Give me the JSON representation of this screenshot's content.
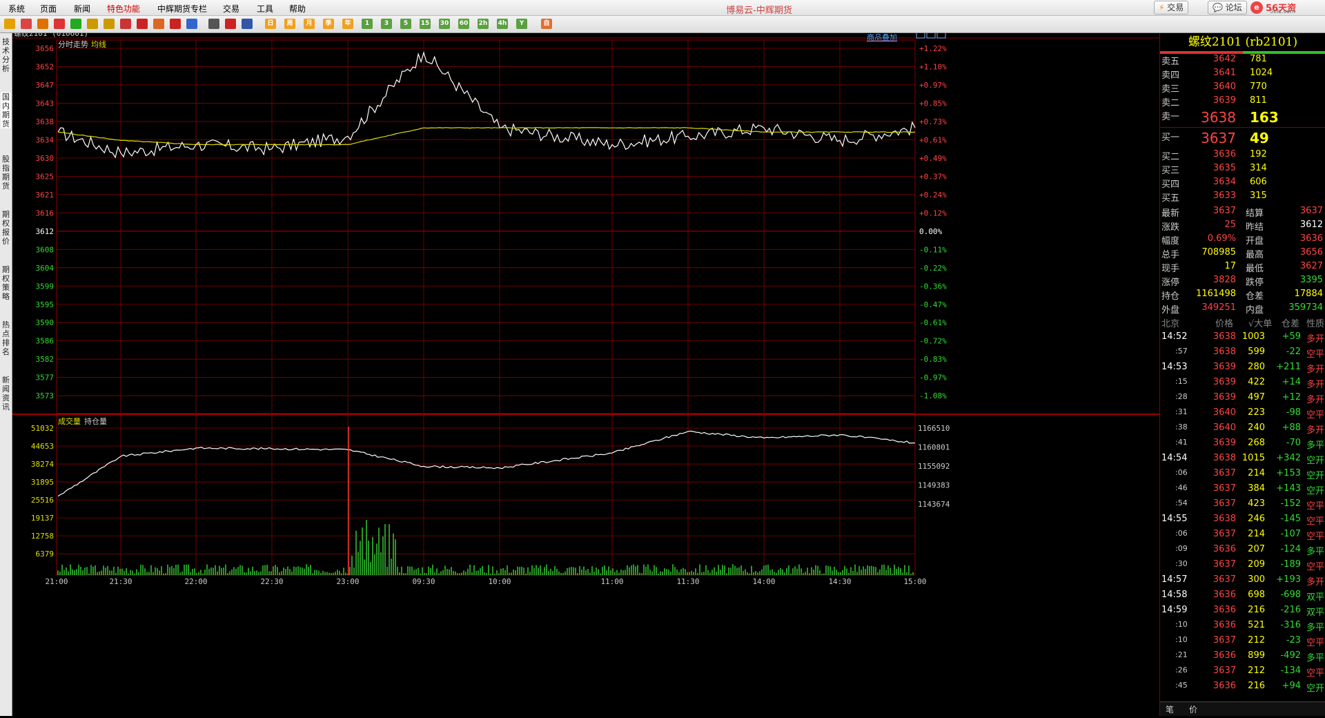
{
  "menu": [
    "系统",
    "页面",
    "新闻",
    "特色功能",
    "中辉期货专栏",
    "交易",
    "工具",
    "帮助"
  ],
  "app_title": "博易云-中辉期货",
  "buttons": {
    "trade": "交易",
    "forum": "论坛"
  },
  "logo": {
    "mark": "e",
    "text": "56天资",
    "sub": "5etz.com"
  },
  "toolbar": {
    "icons": [
      "back-icon",
      "home-icon",
      "book-icon",
      "news-icon",
      "refresh-icon",
      "zoom-in-icon",
      "zoom-out-icon",
      "window-icon",
      "pen-icon",
      "paint-icon",
      "funnel-icon",
      "star-icon",
      "table-icon",
      "chart-icon",
      "split-icon"
    ],
    "periods": [
      "日",
      "周",
      "月",
      "季",
      "年",
      "1",
      "3",
      "5",
      "15",
      "30",
      "60",
      "2h",
      "4h",
      "Y",
      "自"
    ]
  },
  "left_tabs": [
    "技术分析",
    "国内期货",
    "股指期货",
    "期权报价",
    "期权策略",
    "热点排名",
    "新闻资讯"
  ],
  "chart": {
    "symbol": "螺纹2101 (010601)",
    "overlay_link": "商品叠加",
    "price_label": "分时走势",
    "avg_label": "均线",
    "volume_label": "成交量",
    "oi_label": "持仓量",
    "price_ticks": [
      "3656",
      "3652",
      "3647",
      "3643",
      "3638",
      "3634",
      "3630",
      "3625",
      "3621",
      "3616",
      "3612",
      "3608",
      "3604",
      "3599",
      "3595",
      "3590",
      "3586",
      "3582",
      "3577",
      "3573"
    ],
    "pct_ticks": [
      "+1.22%",
      "+1.10%",
      "+0.97%",
      "+0.85%",
      "+0.73%",
      "+0.61%",
      "+0.49%",
      "+0.37%",
      "+0.24%",
      "+0.12%",
      "0.00%",
      "-0.11%",
      "-0.22%",
      "-0.36%",
      "-0.47%",
      "-0.61%",
      "-0.72%",
      "-0.83%",
      "-0.97%",
      "-1.08%"
    ],
    "vol_ticks": [
      "51032",
      "44653",
      "38274",
      "31895",
      "25516",
      "19137",
      "12758",
      "6379"
    ],
    "oi_ticks": [
      "1166510",
      "1160801",
      "1155092",
      "1149383",
      "1143674"
    ],
    "time_ticks": [
      "21:00",
      "21:30",
      "22:00",
      "22:30",
      "23:00",
      "09:30",
      "10:00",
      "11:00",
      "11:30",
      "14:00",
      "14:30",
      "15:00"
    ],
    "colors": {
      "grid": "#8b0000",
      "price_up": "#ff4444",
      "price_down": "#33dd33",
      "line": "#ffffff",
      "avg": "#e0e000"
    }
  },
  "chart_data": {
    "type": "line",
    "title": "螺纹2101 (010601)",
    "x": [
      "21:00",
      "21:30",
      "22:00",
      "22:30",
      "23:00",
      "09:30",
      "10:00",
      "11:00",
      "11:30",
      "14:00",
      "14:30",
      "15:00"
    ],
    "ylim": [
      3573,
      3656
    ],
    "series": [
      {
        "name": "分时走势",
        "values": [
          3636,
          3631,
          3633,
          3632,
          3635,
          3655,
          3637,
          3633,
          3635,
          3637,
          3634,
          3637
        ]
      },
      {
        "name": "均线",
        "values": [
          3636,
          3634,
          3633,
          3633,
          3633,
          3637,
          3637,
          3637,
          3637,
          3636,
          3636,
          3636
        ]
      },
      {
        "name": "持仓量",
        "values": [
          1146000,
          1158000,
          1160500,
          1160300,
          1160000,
          1155000,
          1154500,
          1159000,
          1165500,
          1163500,
          1164500,
          1162000
        ]
      }
    ],
    "volume_ylim": [
      0,
      51032
    ],
    "oi_ylim": [
      1143674,
      1166510
    ]
  },
  "quote": {
    "title": "螺纹2101 (rb2101)",
    "asks": [
      {
        "label": "卖五",
        "price": "3642",
        "vol": "781"
      },
      {
        "label": "卖四",
        "price": "3641",
        "vol": "1024"
      },
      {
        "label": "卖三",
        "price": "3640",
        "vol": "770"
      },
      {
        "label": "卖二",
        "price": "3639",
        "vol": "811"
      },
      {
        "label": "卖一",
        "price": "3638",
        "vol": "163"
      }
    ],
    "bids": [
      {
        "label": "买一",
        "price": "3637",
        "vol": "49"
      },
      {
        "label": "买二",
        "price": "3636",
        "vol": "192"
      },
      {
        "label": "买三",
        "price": "3635",
        "vol": "314"
      },
      {
        "label": "买四",
        "price": "3634",
        "vol": "606"
      },
      {
        "label": "买五",
        "price": "3633",
        "vol": "315"
      }
    ],
    "stats": [
      {
        "l1": "最新",
        "v1": "3637",
        "c1": "red",
        "l2": "结算",
        "v2": "3637",
        "c2": "red"
      },
      {
        "l1": "涨跌",
        "v1": "25",
        "c1": "red",
        "l2": "昨结",
        "v2": "3612",
        "c2": "white"
      },
      {
        "l1": "幅度",
        "v1": "0.69%",
        "c1": "red",
        "l2": "开盘",
        "v2": "3636",
        "c2": "red"
      },
      {
        "l1": "总手",
        "v1": "708985",
        "c1": "yellow",
        "l2": "最高",
        "v2": "3656",
        "c2": "red"
      },
      {
        "l1": "现手",
        "v1": "17",
        "c1": "yellow",
        "l2": "最低",
        "v2": "3627",
        "c2": "red"
      },
      {
        "l1": "涨停",
        "v1": "3828",
        "c1": "red",
        "l2": "跌停",
        "v2": "3395",
        "c2": "green"
      },
      {
        "l1": "持仓",
        "v1": "1161498",
        "c1": "yellow",
        "l2": "仓差",
        "v2": "17884",
        "c2": "yellow"
      },
      {
        "l1": "外盘",
        "v1": "349251",
        "c1": "red",
        "l2": "内盘",
        "v2": "359734",
        "c2": "green"
      }
    ],
    "ticks_header": [
      "北京",
      "价格",
      "√大单",
      "仓差",
      "性质"
    ],
    "ticks": [
      {
        "t": "14:52",
        "sub": false,
        "p": "3638",
        "v": "1003",
        "d": "+59",
        "dc": "green",
        "k": "多开",
        "kc": "red"
      },
      {
        "t": ":57",
        "sub": true,
        "p": "3638",
        "v": "599",
        "d": "-22",
        "dc": "green",
        "k": "空平",
        "kc": "red"
      },
      {
        "t": "14:53",
        "sub": false,
        "p": "3639",
        "v": "280",
        "d": "+211",
        "dc": "green",
        "k": "多开",
        "kc": "red"
      },
      {
        "t": ":15",
        "sub": true,
        "p": "3639",
        "v": "422",
        "d": "+14",
        "dc": "green",
        "k": "多开",
        "kc": "red"
      },
      {
        "t": ":28",
        "sub": true,
        "p": "3639",
        "v": "497",
        "d": "+12",
        "dc": "green",
        "k": "多开",
        "kc": "red"
      },
      {
        "t": ":31",
        "sub": true,
        "p": "3640",
        "v": "223",
        "d": "-98",
        "dc": "green",
        "k": "空平",
        "kc": "red"
      },
      {
        "t": ":38",
        "sub": true,
        "p": "3640",
        "v": "240",
        "d": "+88",
        "dc": "green",
        "k": "多开",
        "kc": "red"
      },
      {
        "t": ":41",
        "sub": true,
        "p": "3639",
        "v": "268",
        "d": "-70",
        "dc": "green",
        "k": "多平",
        "kc": "green"
      },
      {
        "t": "14:54",
        "sub": false,
        "p": "3638",
        "v": "1015",
        "d": "+342",
        "dc": "green",
        "k": "空开",
        "kc": "green"
      },
      {
        "t": ":06",
        "sub": true,
        "p": "3637",
        "v": "214",
        "d": "+153",
        "dc": "green",
        "k": "空开",
        "kc": "green"
      },
      {
        "t": ":46",
        "sub": true,
        "p": "3637",
        "v": "384",
        "d": "+143",
        "dc": "green",
        "k": "空开",
        "kc": "green"
      },
      {
        "t": ":54",
        "sub": true,
        "p": "3637",
        "v": "423",
        "d": "-152",
        "dc": "green",
        "k": "空平",
        "kc": "red"
      },
      {
        "t": "14:55",
        "sub": false,
        "p": "3638",
        "v": "246",
        "d": "-145",
        "dc": "green",
        "k": "空平",
        "kc": "red"
      },
      {
        "t": ":06",
        "sub": true,
        "p": "3637",
        "v": "214",
        "d": "-107",
        "dc": "green",
        "k": "空平",
        "kc": "red"
      },
      {
        "t": ":09",
        "sub": true,
        "p": "3636",
        "v": "207",
        "d": "-124",
        "dc": "green",
        "k": "多平",
        "kc": "green"
      },
      {
        "t": ":30",
        "sub": true,
        "p": "3637",
        "v": "209",
        "d": "-189",
        "dc": "green",
        "k": "空平",
        "kc": "red"
      },
      {
        "t": "14:57",
        "sub": false,
        "p": "3637",
        "v": "300",
        "d": "+193",
        "dc": "green",
        "k": "多开",
        "kc": "red"
      },
      {
        "t": "14:58",
        "sub": false,
        "p": "3636",
        "v": "698",
        "d": "-698",
        "dc": "green",
        "k": "双平",
        "kc": "green"
      },
      {
        "t": "14:59",
        "sub": false,
        "p": "3636",
        "v": "216",
        "d": "-216",
        "dc": "green",
        "k": "双平",
        "kc": "green"
      },
      {
        "t": ":10",
        "sub": true,
        "p": "3636",
        "v": "521",
        "d": "-316",
        "dc": "green",
        "k": "多平",
        "kc": "green"
      },
      {
        "t": ":10",
        "sub": true,
        "p": "3637",
        "v": "212",
        "d": "-23",
        "dc": "green",
        "k": "空平",
        "kc": "red"
      },
      {
        "t": ":21",
        "sub": true,
        "p": "3636",
        "v": "899",
        "d": "-492",
        "dc": "green",
        "k": "多平",
        "kc": "green"
      },
      {
        "t": ":26",
        "sub": true,
        "p": "3637",
        "v": "212",
        "d": "-134",
        "dc": "green",
        "k": "空平",
        "kc": "red"
      },
      {
        "t": ":45",
        "sub": true,
        "p": "3636",
        "v": "216",
        "d": "+94",
        "dc": "green",
        "k": "空开",
        "kc": "green"
      }
    ],
    "bottom_tabs": [
      "笔",
      "价"
    ]
  }
}
